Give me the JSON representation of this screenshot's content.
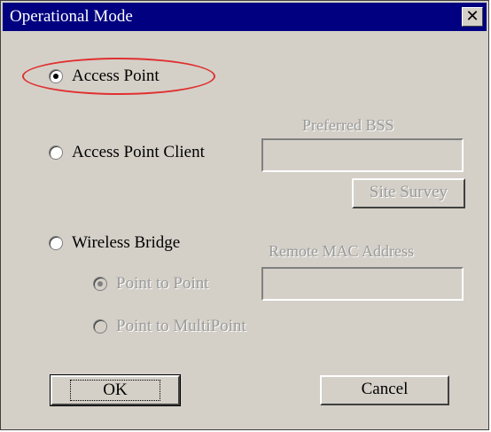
{
  "title": "Operational Mode",
  "close_symbol": "✕",
  "modes": {
    "access_point": "Access Point",
    "access_point_client": "Access Point Client",
    "wireless_bridge": "Wireless Bridge"
  },
  "selected_mode": "Access Point",
  "bridge_modes": {
    "point_to_point": "Point to Point",
    "point_to_multipoint": "Point to MultiPoint"
  },
  "preferred_bss": {
    "label": "Preferred BSS",
    "value": ""
  },
  "site_survey_label": "Site Survey",
  "remote_mac": {
    "label": "Remote MAC Address",
    "value": ""
  },
  "buttons": {
    "ok": "OK",
    "cancel": "Cancel"
  },
  "annotation": {
    "ellipse_color": "#e03030"
  }
}
